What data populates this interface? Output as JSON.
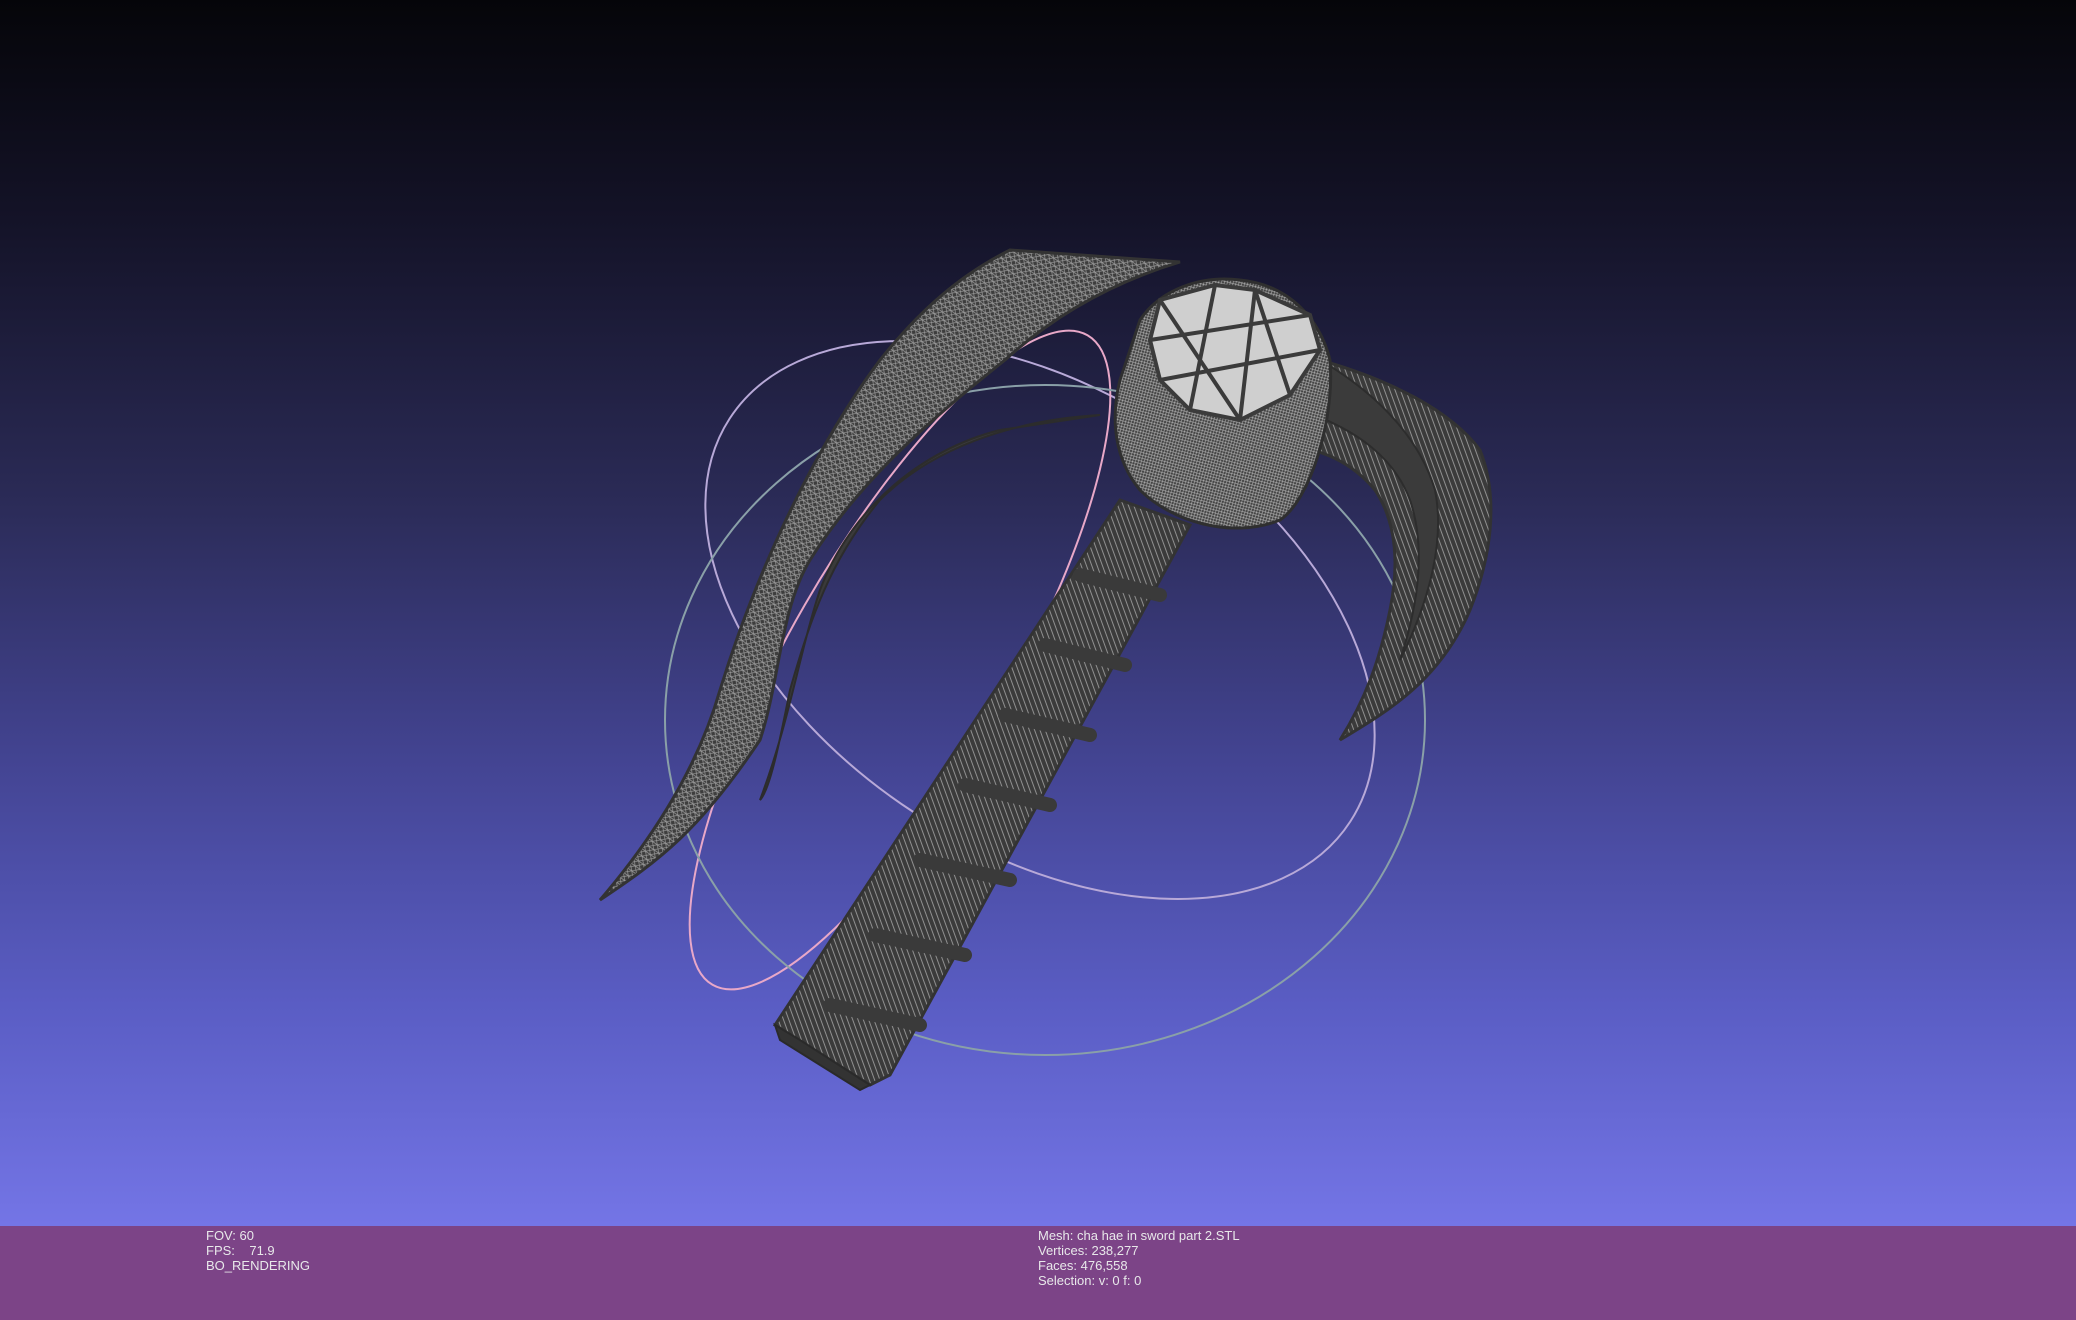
{
  "viewport": {
    "background_top": "#050509",
    "background_bottom": "#7475e6",
    "model_color": "#3d3d3d",
    "wire_color": "#9a9a9a",
    "trackball_colors": [
      "#b8a9d8",
      "#e8a8c8",
      "#8aa0a8"
    ]
  },
  "status": {
    "background": "#7c4487",
    "fov": "FOV: 60",
    "fps": "FPS:    71.9",
    "render_mode": "BO_RENDERING",
    "mesh": "Mesh: cha hae in sword part 2.STL",
    "vertices": "Vertices: 238,277",
    "faces": "Faces: 476,558",
    "selection": "Selection: v: 0 f: 0"
  }
}
